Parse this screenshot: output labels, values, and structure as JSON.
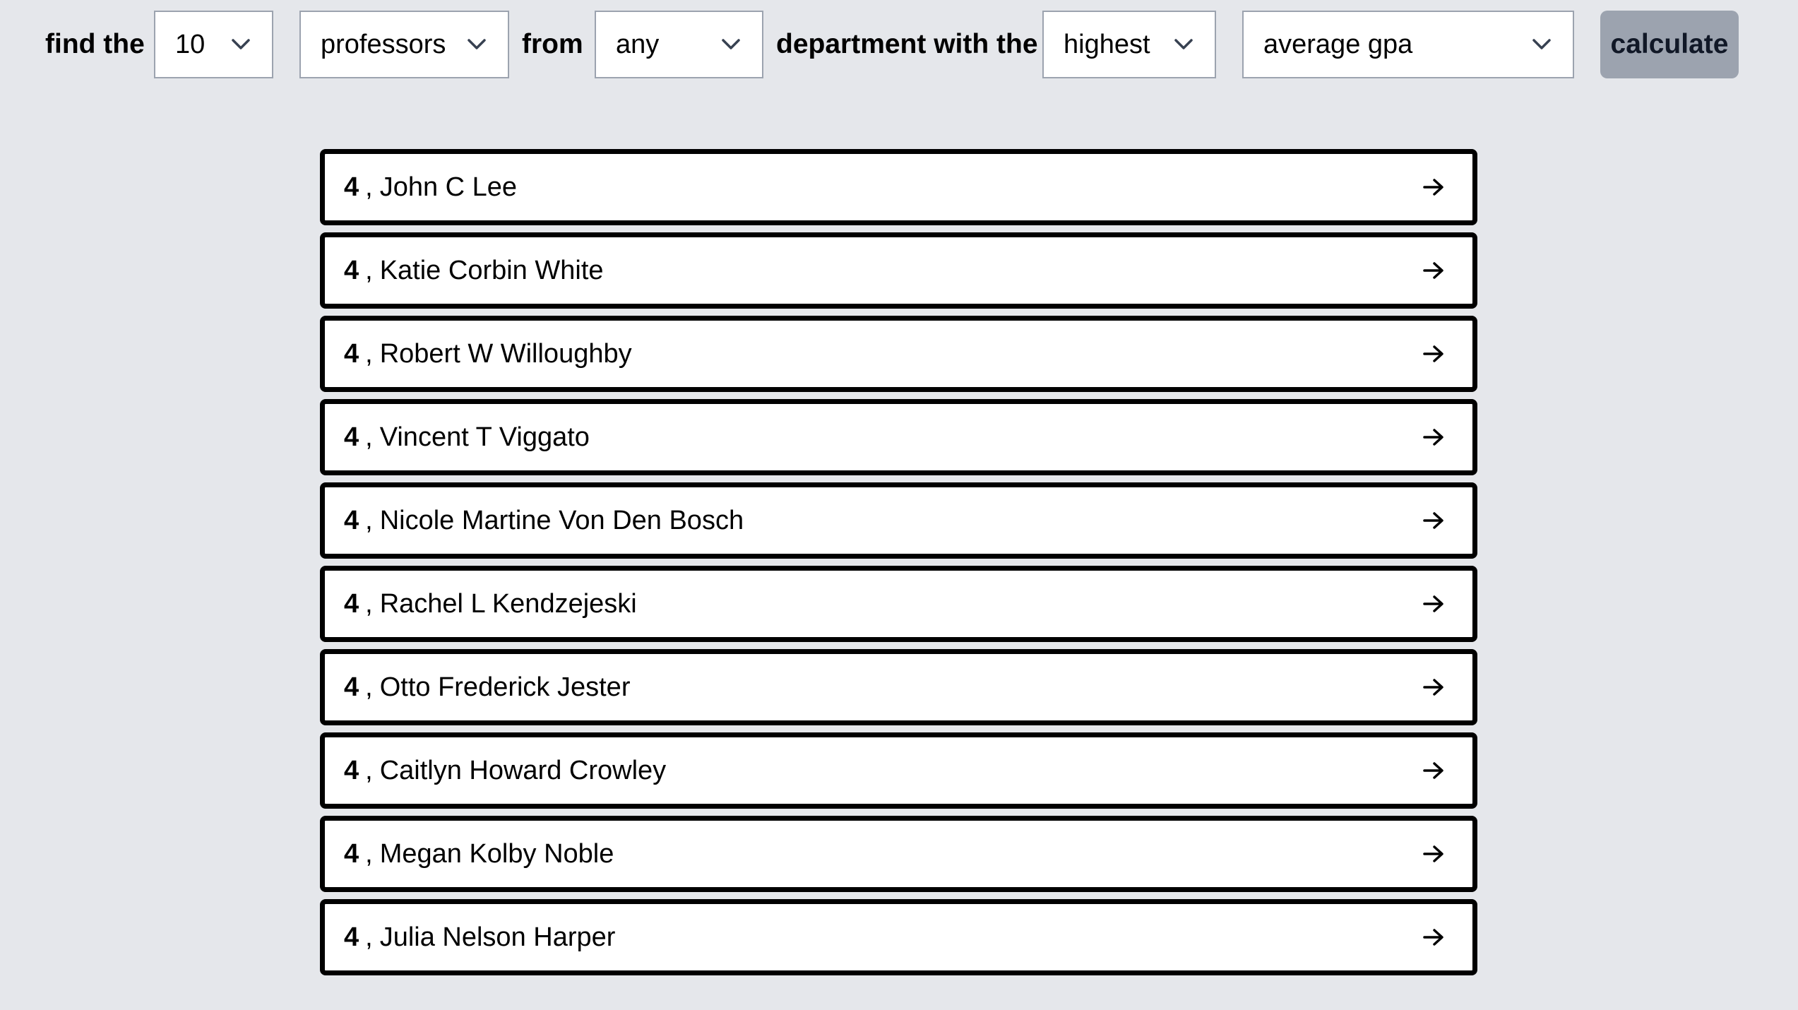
{
  "query": {
    "word_find": "find the",
    "count_value": "10",
    "entity_value": "professors",
    "word_from": "from",
    "department_value": "any",
    "word_department": "department with the",
    "order_value": "highest",
    "metric_value": "average gpa",
    "calculate_label": "calculate"
  },
  "icons": {
    "dropdown": "chevron-down-icon",
    "row_link": "arrow-right-icon"
  },
  "colors": {
    "page_background": "#e5e7eb",
    "row_border": "#000000",
    "button_background": "#9ca3af"
  },
  "results": [
    {
      "score": "4",
      "separator": ",",
      "name": "John C Lee"
    },
    {
      "score": "4",
      "separator": ",",
      "name": "Katie Corbin White"
    },
    {
      "score": "4",
      "separator": ",",
      "name": "Robert W Willoughby"
    },
    {
      "score": "4",
      "separator": ",",
      "name": "Vincent T Viggato"
    },
    {
      "score": "4",
      "separator": ",",
      "name": "Nicole Martine Von Den Bosch"
    },
    {
      "score": "4",
      "separator": ",",
      "name": "Rachel L Kendzejeski"
    },
    {
      "score": "4",
      "separator": ",",
      "name": "Otto Frederick Jester"
    },
    {
      "score": "4",
      "separator": ",",
      "name": "Caitlyn Howard Crowley"
    },
    {
      "score": "4",
      "separator": ",",
      "name": "Megan Kolby Noble"
    },
    {
      "score": "4",
      "separator": ",",
      "name": "Julia Nelson Harper"
    }
  ]
}
